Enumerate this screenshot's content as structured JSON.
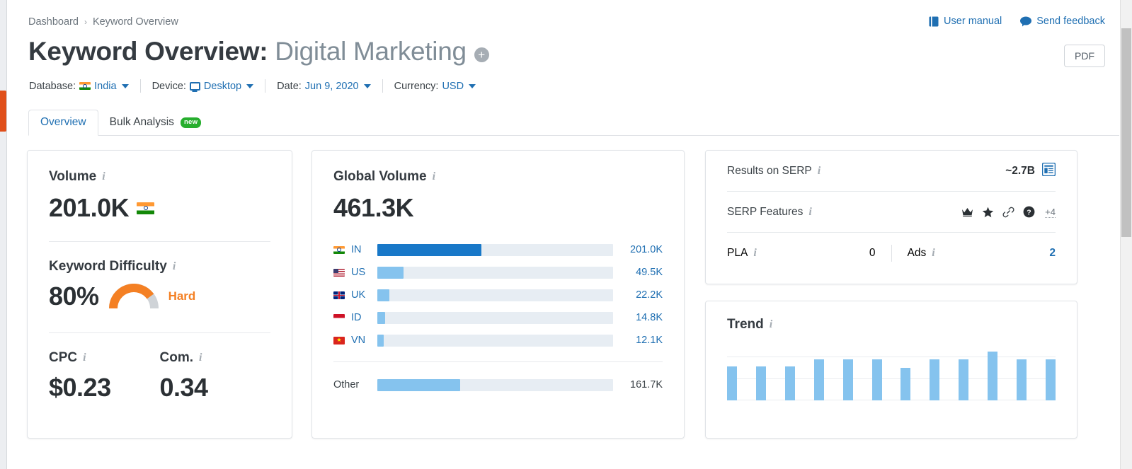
{
  "breadcrumb": {
    "items": [
      "Dashboard",
      "Keyword Overview"
    ],
    "separator": "›"
  },
  "header": {
    "user_manual": "User manual",
    "send_feedback": "Send feedback",
    "pdf_button": "PDF",
    "title_prefix": "Keyword Overview:",
    "keyword": "Digital Marketing",
    "add_icon": "+"
  },
  "filters": {
    "database_label": "Database:",
    "database_value": "India",
    "device_label": "Device:",
    "device_value": "Desktop",
    "date_label": "Date:",
    "date_value": "Jun 9, 2020",
    "currency_label": "Currency:",
    "currency_value": "USD"
  },
  "tabs": [
    {
      "label": "Overview",
      "active": true,
      "badge": ""
    },
    {
      "label": "Bulk Analysis",
      "active": false,
      "badge": "new"
    }
  ],
  "volume_card": {
    "volume_label": "Volume",
    "volume_value": "201.0K",
    "volume_flag": "in",
    "kd_label": "Keyword Difficulty",
    "kd_value": "80%",
    "kd_percent": 80,
    "kd_word": "Hard",
    "kd_color": "#f48024",
    "cpc_label": "CPC",
    "cpc_value": "$0.23",
    "com_label": "Com.",
    "com_value": "0.34"
  },
  "global_card": {
    "title": "Global Volume",
    "total": "461.3K",
    "other_label": "Other",
    "other_value": "161.7K",
    "other_pct": 35
  },
  "serp_card": {
    "results_label": "Results on SERP",
    "results_value": "~2.7B",
    "features_label": "SERP Features",
    "features_icons": [
      "crown-icon",
      "star-icon",
      "link-icon",
      "question-circle-icon"
    ],
    "features_more": "+4",
    "pla_label": "PLA",
    "pla_value": "0",
    "ads_label": "Ads",
    "ads_value": "2"
  },
  "trend_card": {
    "title": "Trend"
  },
  "colors": {
    "accent_blue": "#1f6fb2",
    "bar_primary": "#1878c8",
    "bar_secondary": "#85c3ee",
    "bar_track": "#e7edf3",
    "orange": "#f48024",
    "green": "#27ae2e",
    "red_rail": "#e04f1a"
  },
  "chart_data": [
    {
      "type": "bar",
      "title": "Global Volume",
      "orientation": "horizontal",
      "categories": [
        "IN",
        "US",
        "UK",
        "ID",
        "VN",
        "Other"
      ],
      "values": [
        201000,
        49500,
        22200,
        14800,
        12100,
        161700
      ],
      "value_labels": [
        "201.0K",
        "49.5K",
        "22.2K",
        "14.8K",
        "12.1K",
        "161.7K"
      ],
      "bar_percents": [
        44,
        11,
        5,
        3.4,
        2.8,
        35
      ],
      "flags": [
        "in",
        "us",
        "uk",
        "id",
        "vn",
        null
      ],
      "highlight_index": 0,
      "xlabel": "",
      "ylabel": "",
      "grid": false,
      "legend": "none",
      "total": 461300,
      "total_label": "461.3K"
    },
    {
      "type": "bar",
      "title": "Trend",
      "orientation": "vertical",
      "categories": [
        "1",
        "2",
        "3",
        "4",
        "5",
        "6",
        "7",
        "8",
        "9",
        "10",
        "11",
        "12"
      ],
      "values": [
        62,
        62,
        62,
        74,
        74,
        74,
        59,
        74,
        74,
        88,
        74,
        74
      ],
      "ylim": [
        0,
        100
      ],
      "grid": true,
      "gridlines": [
        40,
        80
      ],
      "legend": "none",
      "xlabel": "",
      "ylabel": ""
    }
  ]
}
